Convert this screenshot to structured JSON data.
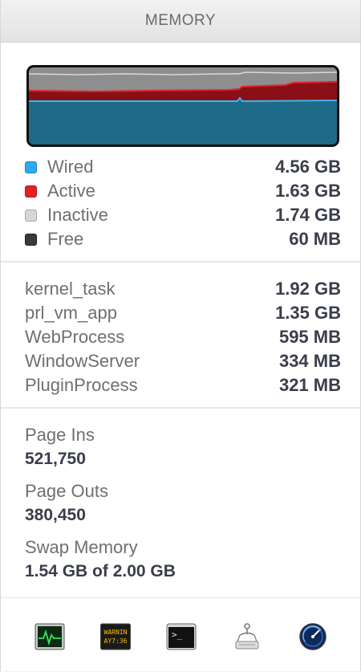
{
  "header": {
    "title": "MEMORY"
  },
  "graph": {
    "colors": {
      "wired": "#1d6b88",
      "wired_line": "#3db6e8",
      "active": "#8a0f16",
      "active_line": "#e0202a",
      "inactive": "#8e8e8e",
      "inactive_line": "#d8d8d8"
    }
  },
  "memory_breakdown": [
    {
      "label": "Wired",
      "value": "4.56 GB",
      "color": "#2eaaf0"
    },
    {
      "label": "Active",
      "value": "1.63 GB",
      "color": "#e51f26"
    },
    {
      "label": "Inactive",
      "value": "1.74 GB",
      "color": "#cfcfcf"
    },
    {
      "label": "Free",
      "value": "60 MB",
      "color": "#3a3a3a"
    }
  ],
  "processes": [
    {
      "name": "kernel_task",
      "value": "1.92 GB"
    },
    {
      "name": "prl_vm_app",
      "value": "1.35 GB"
    },
    {
      "name": "WebProcess",
      "value": "595 MB"
    },
    {
      "name": "WindowServer",
      "value": "334 MB"
    },
    {
      "name": "PluginProcess",
      "value": "321 MB"
    }
  ],
  "stats": {
    "page_ins": {
      "label": "Page Ins",
      "value": "521,750"
    },
    "page_outs": {
      "label": "Page Outs",
      "value": "380,450"
    },
    "swap": {
      "label": "Swap Memory",
      "value": "1.54 GB of 2.00 GB"
    }
  },
  "toolbar": {
    "items": [
      {
        "icon": "activity-monitor-icon"
      },
      {
        "icon": "console-icon",
        "text_line1": "WARNIN",
        "text_line2": "AY7:36"
      },
      {
        "icon": "terminal-icon",
        "text": ">_"
      },
      {
        "icon": "disk-utility-icon"
      },
      {
        "icon": "network-utility-icon"
      }
    ]
  }
}
